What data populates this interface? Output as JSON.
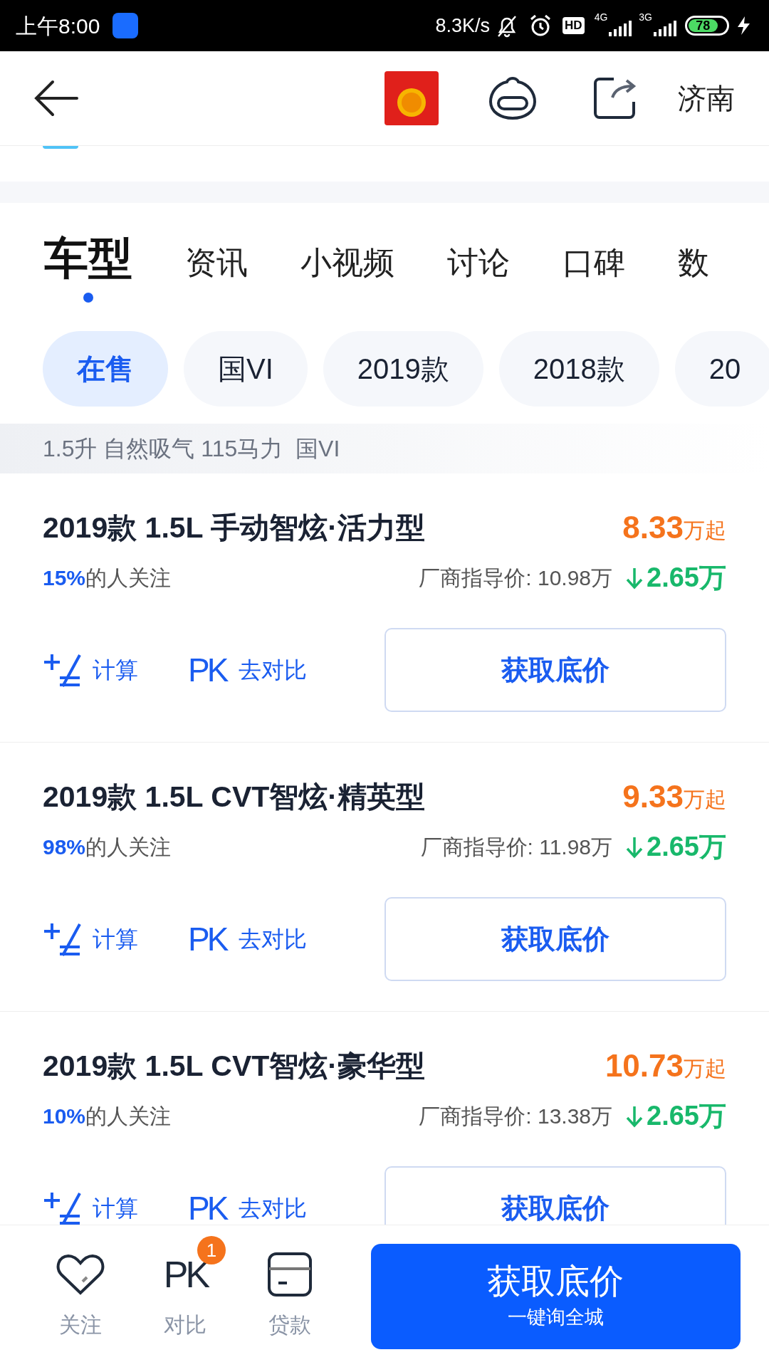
{
  "status_bar": {
    "time": "上午8:00",
    "speed": "8.3K/s",
    "hd": "HD",
    "net_1": "4G",
    "net_2": "3G",
    "battery": "78"
  },
  "header": {
    "city": "济南"
  },
  "tabs": [
    {
      "label": "车型",
      "selected": true
    },
    {
      "label": "资讯",
      "selected": false
    },
    {
      "label": "小视频",
      "selected": false
    },
    {
      "label": "讨论",
      "selected": false
    },
    {
      "label": "口碑",
      "selected": false
    },
    {
      "label": "数",
      "selected": false
    }
  ],
  "chips": [
    {
      "label": "在售",
      "selected": true
    },
    {
      "label": "国VI",
      "selected": false
    },
    {
      "label": "2019款",
      "selected": false
    },
    {
      "label": "2018款",
      "selected": false
    },
    {
      "label": "20",
      "selected": false
    }
  ],
  "spec_line": "1.5升 自然吸气 115马力  国VI",
  "models": [
    {
      "name": "2019款 1.5L 手动智炫·活力型",
      "price": "8.33",
      "price_unit": "万起",
      "attention": "15%",
      "attention_text": "的人关注",
      "guide_label": "厂商指导价: ",
      "guide_price": "10.98万",
      "drop": "2.65万",
      "calc": "计算",
      "compare_icon": "PK",
      "compare": "去对比",
      "action": "获取底价"
    },
    {
      "name": "2019款 1.5L CVT智炫·精英型",
      "price": "9.33",
      "price_unit": "万起",
      "attention": "98%",
      "attention_text": "的人关注",
      "guide_label": "厂商指导价: ",
      "guide_price": "11.98万",
      "drop": "2.65万",
      "calc": "计算",
      "compare_icon": "PK",
      "compare": "去对比",
      "action": "获取底价"
    },
    {
      "name": "2019款 1.5L CVT智炫·豪华型",
      "price": "10.73",
      "price_unit": "万起",
      "attention": "10%",
      "attention_text": "的人关注",
      "guide_label": "厂商指导价: ",
      "guide_price": "13.38万",
      "drop": "2.65万",
      "calc": "计算",
      "compare_icon": "PK",
      "compare": "去对比",
      "action": "获取底价"
    }
  ],
  "bottom_bar": {
    "items": [
      {
        "kind": "heart",
        "label": "关注"
      },
      {
        "kind": "pk",
        "label": "对比",
        "icon_text": "PK",
        "badge": "1"
      },
      {
        "kind": "card",
        "label": "贷款"
      }
    ],
    "cta": {
      "title": "获取底价",
      "subtitle": "一键询全城"
    }
  }
}
